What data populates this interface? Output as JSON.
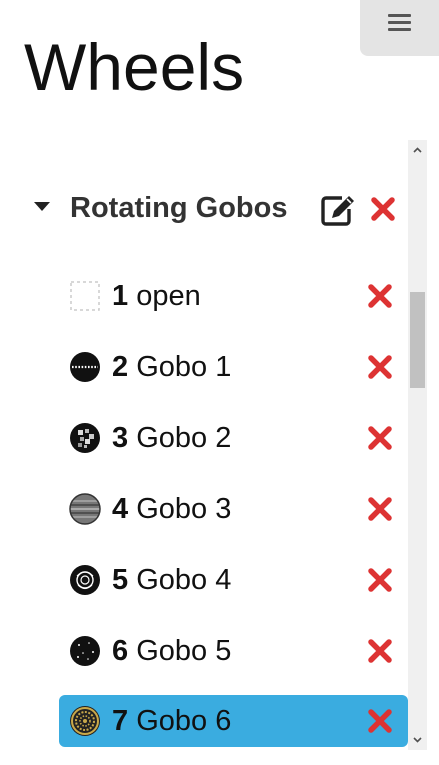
{
  "page": {
    "title": "Wheels",
    "menu_icon": "hamburger-menu-icon"
  },
  "wheel": {
    "name": "Rotating Gobos",
    "expanded": true,
    "edit_icon": "edit-icon",
    "delete_icon": "delete-icon"
  },
  "slots": [
    {
      "number": "1",
      "name": "open",
      "thumbnail": "open-slot-icon",
      "selected": false
    },
    {
      "number": "2",
      "name": "Gobo 1",
      "thumbnail": "gobo-dotted-line-icon",
      "selected": false
    },
    {
      "number": "3",
      "name": "Gobo 2",
      "thumbnail": "gobo-squares-icon",
      "selected": false
    },
    {
      "number": "4",
      "name": "Gobo 3",
      "thumbnail": "gobo-stripes-icon",
      "selected": false
    },
    {
      "number": "5",
      "name": "Gobo 4",
      "thumbnail": "gobo-rose-icon",
      "selected": false
    },
    {
      "number": "6",
      "name": "Gobo 5",
      "thumbnail": "gobo-stars-icon",
      "selected": false
    },
    {
      "number": "7",
      "name": "Gobo 6",
      "thumbnail": "gobo-radial-icon",
      "selected": true
    }
  ],
  "colors": {
    "selected_row": "#3aace0",
    "delete_red": "#dd3333",
    "menu_button_bg": "#e4e4e4"
  }
}
